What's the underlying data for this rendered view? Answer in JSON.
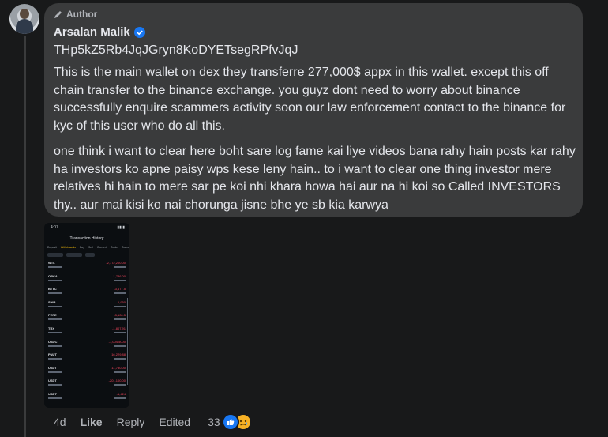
{
  "comment": {
    "badge": "Author",
    "author_name": "Arsalan Malik",
    "paragraphs": [
      "THp5kZ5Rb4JqJGryn8KoDYETsegRPfvJqJ",
      "This is the main wallet on dex they transferre 277,000$ appx in this wallet. except this off chain transfer to the binance exchange. you guyz dont need to worry about binance successfully enquire scammers activity soon our law enforcement contact to the binance for kyc of this user who do all this.",
      "one think i want to clear here boht sare log fame kai liye videos bana rahy hain posts kar rahy ha investors ko apne paisy wps kese leny hain.. to i want to clear one thing investor mere relatives hi hain to mere sar pe koi nhi khara howa hai aur na hi koi so Called INVESTORS thy.. aur mai kisi ko nai chorunga jisne bhe ye sb kia karwya"
    ]
  },
  "attachment": {
    "status_time": "4:07",
    "title": "Transaction History",
    "tabs": [
      "Deposit",
      "Withdrawals",
      "Buy",
      "Sell",
      "Convert",
      "Trade",
      "Transf"
    ],
    "rows": [
      {
        "coin": "WTL",
        "amount": "-2,172,200.00"
      },
      {
        "coin": "ORCA",
        "amount": "-1,786.00"
      },
      {
        "coin": "BTTC",
        "amount": "-3,677.5"
      },
      {
        "coin": "SHIB",
        "amount": "-1,950"
      },
      {
        "coin": "PEPE",
        "amount": "-3,100.5"
      },
      {
        "coin": "TRX",
        "amount": "-1,807.91"
      },
      {
        "coin": "USDC",
        "amount": "-1,004,5000"
      },
      {
        "coin": "PNUT",
        "amount": "-16,229.88"
      },
      {
        "coin": "USDT",
        "amount": "-11,780.00"
      },
      {
        "coin": "USDT",
        "amount": "-201,100.00"
      },
      {
        "coin": "USDT",
        "amount": "-1,424"
      }
    ]
  },
  "actions": {
    "time": "4d",
    "like": "Like",
    "reply": "Reply",
    "edited": "Edited",
    "reaction_count": "33"
  },
  "icons": [
    "pencil-icon",
    "verified-icon",
    "thumbs-up-icon",
    "sad-face-icon"
  ],
  "colors": {
    "background": "#18191a",
    "bubble": "#3a3b3c",
    "accent": "#1877f2",
    "negative": "#f6465d"
  }
}
